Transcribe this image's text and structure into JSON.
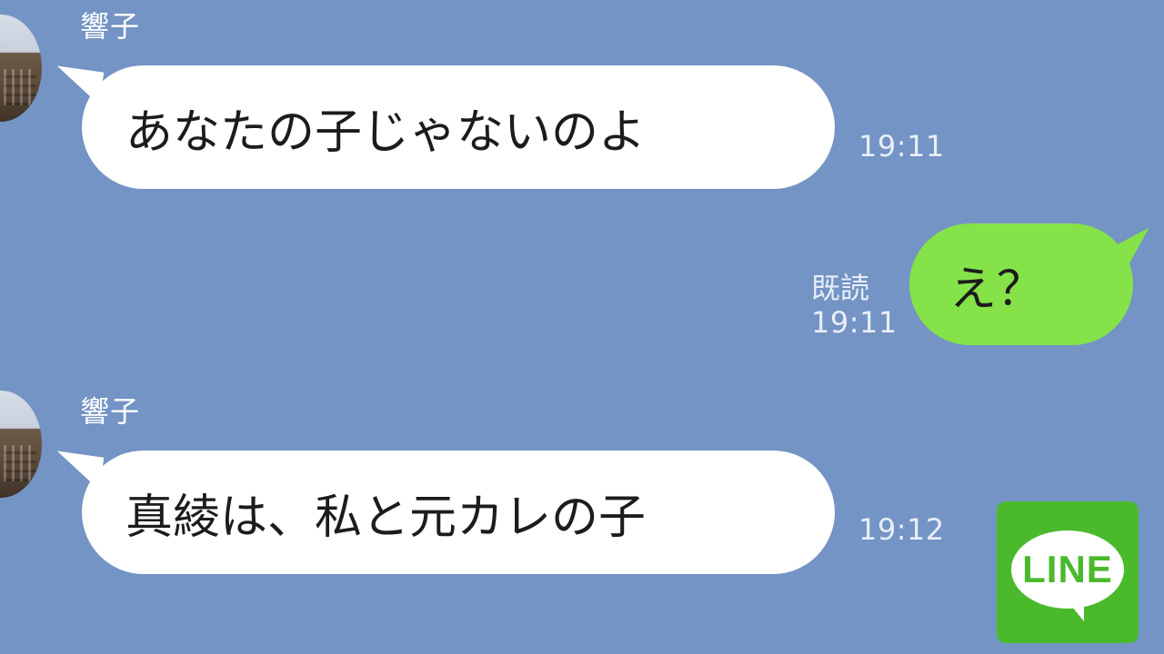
{
  "app": {
    "name": "LINE"
  },
  "colors": {
    "background": "#7394c4",
    "incoming_bubble": "#ffffff",
    "outgoing_bubble": "#85e249",
    "logo_green": "#4aba2c"
  },
  "messages": [
    {
      "sender": "響子",
      "text": "あなたの子じゃないのよ",
      "time": "19:11",
      "direction": "incoming"
    },
    {
      "text": "え？",
      "time": "19:11",
      "status": "既読",
      "direction": "outgoing"
    },
    {
      "sender": "響子",
      "text": "真綾は、私と元カレの子",
      "time": "19:12",
      "direction": "incoming"
    }
  ],
  "logo": {
    "text": "LINE",
    "icon": "line-logo-icon"
  }
}
